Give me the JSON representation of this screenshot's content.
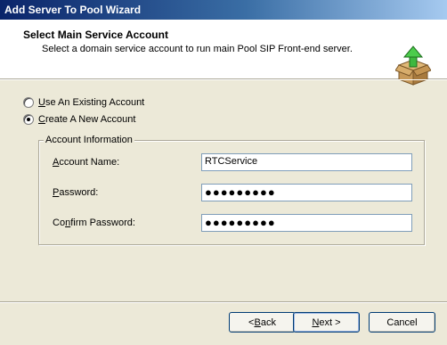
{
  "window": {
    "title": "Add Server To Pool Wizard"
  },
  "header": {
    "title": "Select Main Service Account",
    "subtitle": "Select a domain service account to run main Pool SIP Front-end server.",
    "icon": "package-box-upload-icon"
  },
  "options": [
    {
      "pre": "",
      "accel": "U",
      "post": "se An Existing Account",
      "checked": false
    },
    {
      "pre": "",
      "accel": "C",
      "post": "reate A New Account",
      "checked": true
    }
  ],
  "group": {
    "legend": "Account Information"
  },
  "fields": {
    "account_name": {
      "pre": "",
      "accel": "A",
      "post": "ccount Name:",
      "value": "RTCService"
    },
    "password": {
      "pre": "",
      "accel": "P",
      "post": "assword:",
      "value": "●●●●●●●●●"
    },
    "confirm_password": {
      "pre": "Co",
      "accel": "n",
      "post": "firm Password:",
      "value": "●●●●●●●●●"
    }
  },
  "buttons": {
    "back": {
      "pre": "< ",
      "accel": "B",
      "post": "ack"
    },
    "next": {
      "pre": "",
      "accel": "N",
      "post": "ext >"
    },
    "cancel": {
      "label": "Cancel"
    }
  }
}
